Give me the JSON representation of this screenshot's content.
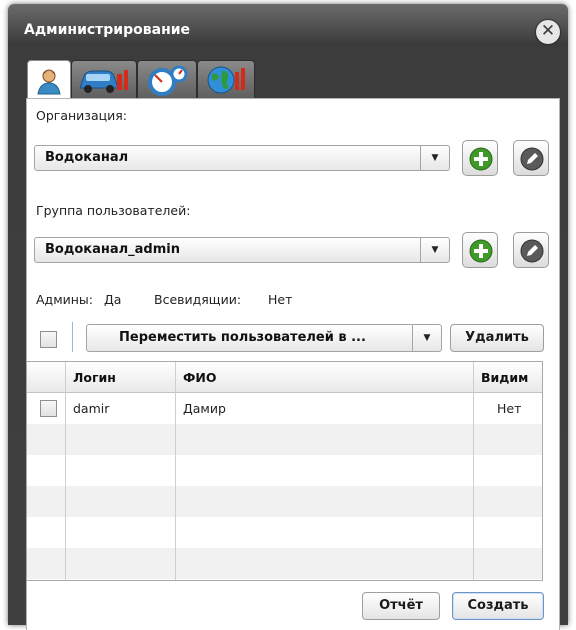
{
  "window": {
    "title": "Администрирование",
    "close_icon": "close-icon"
  },
  "tabs": [
    {
      "name": "users-tab",
      "icon": "user-icon",
      "active": true
    },
    {
      "name": "vehicles-tab",
      "icon": "vehicle-settings-icon",
      "active": false
    },
    {
      "name": "sensors-tab",
      "icon": "gauge-icon",
      "active": false
    },
    {
      "name": "map-tab",
      "icon": "globe-settings-icon",
      "active": false
    }
  ],
  "organization": {
    "label": "Организация:",
    "selected": "Водоканал",
    "add_icon": "add-icon",
    "edit_icon": "edit-icon"
  },
  "user_group": {
    "label": "Группа пользователей:",
    "selected": "Водоканал_admin",
    "add_icon": "add-icon",
    "edit_icon": "edit-icon"
  },
  "flags": {
    "admins_label": "Админы:",
    "admins_value": "Да",
    "all_seeing_label": "Всевидящии:",
    "all_seeing_value": "Нет"
  },
  "actions": {
    "move_users": "Переместить пользователей в ...",
    "delete": "Удалить"
  },
  "table": {
    "columns": [
      "Логин",
      "ФИО",
      "Видим"
    ],
    "rows": [
      {
        "login": "damir",
        "name": "Дамир",
        "visible": "Нет"
      }
    ]
  },
  "footer": {
    "report": "Отчёт",
    "create": "Создать"
  },
  "colors": {
    "add_green": "#3f9a2a",
    "edit_gray": "#5a5a5a",
    "title_bar": "#4a4a4a"
  }
}
